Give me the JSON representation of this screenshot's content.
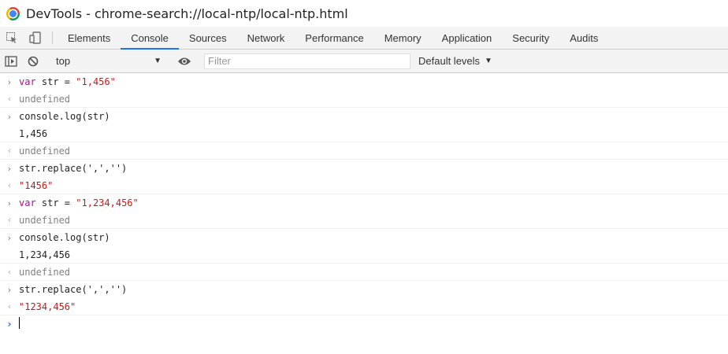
{
  "window": {
    "title": "DevTools - chrome-search://local-ntp/local-ntp.html"
  },
  "tabs": [
    {
      "label": "Elements"
    },
    {
      "label": "Console",
      "active": true
    },
    {
      "label": "Sources"
    },
    {
      "label": "Network"
    },
    {
      "label": "Performance"
    },
    {
      "label": "Memory"
    },
    {
      "label": "Application"
    },
    {
      "label": "Security"
    },
    {
      "label": "Audits"
    }
  ],
  "toolbar": {
    "context": "top",
    "filter_placeholder": "Filter",
    "levels": "Default levels"
  },
  "console": {
    "entries": [
      {
        "type": "input",
        "prefix": "var",
        "text": " str = ",
        "string": "\"1,456\""
      },
      {
        "type": "result",
        "text": "undefined"
      },
      {
        "type": "input",
        "text": "console.log(str)"
      },
      {
        "type": "log",
        "text": "1,456"
      },
      {
        "type": "result",
        "text": "undefined"
      },
      {
        "type": "input",
        "text": "str.replace(',','')"
      },
      {
        "type": "result-string",
        "text": "\"1456\""
      },
      {
        "type": "input",
        "prefix": "var",
        "text": " str = ",
        "string": "\"1,234,456\""
      },
      {
        "type": "result",
        "text": "undefined"
      },
      {
        "type": "input",
        "text": "console.log(str)"
      },
      {
        "type": "log",
        "text": "1,234,456"
      },
      {
        "type": "result",
        "text": "undefined"
      },
      {
        "type": "input",
        "text": "str.replace(',','')"
      },
      {
        "type": "result-string",
        "text": "\"1234,456\""
      }
    ],
    "prompt_value": ""
  }
}
